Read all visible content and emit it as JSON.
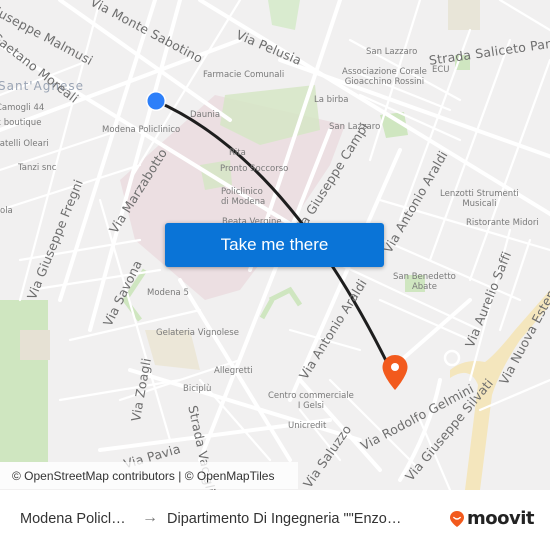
{
  "map": {
    "district": "Sant'Agnese",
    "streets": [
      {
        "id": "monte-sabotino",
        "name": "Via Monte Sabotino"
      },
      {
        "id": "malmusi",
        "name": "Via Giuseppe Malmusi"
      },
      {
        "id": "moreali",
        "name": "Viale Gaetano Moreali"
      },
      {
        "id": "pelusia",
        "name": "Via Pelusia"
      },
      {
        "id": "saliceto",
        "name": "Strada Saliceto Panaro"
      },
      {
        "id": "marzabotto",
        "name": "Via Marzabotto"
      },
      {
        "id": "fregni",
        "name": "Via Giuseppe Fregni"
      },
      {
        "id": "savona",
        "name": "Via Savona"
      },
      {
        "id": "campi",
        "name": "Via Giuseppe Campi"
      },
      {
        "id": "araldi-n",
        "name": "Via Antonio Araldi"
      },
      {
        "id": "araldi-s",
        "name": "Via Antonio Araldi"
      },
      {
        "id": "saffi",
        "name": "Via Aurelio Saffi"
      },
      {
        "id": "estense",
        "name": "Via Nuova Estense"
      },
      {
        "id": "zoagli",
        "name": "Via Zoagli"
      },
      {
        "id": "vaciglio",
        "name": "Strada Vaciglio"
      },
      {
        "id": "pavia",
        "name": "Via Pavia"
      },
      {
        "id": "gelmini",
        "name": "Via Rodolfo Gelmini"
      },
      {
        "id": "silvati",
        "name": "Via Giuseppe Silvati"
      },
      {
        "id": "saluzzo",
        "name": "Via Saluzzo"
      }
    ],
    "pois": [
      {
        "id": "farmacie",
        "name": "Farmacie Comunali"
      },
      {
        "id": "san-lazzaro-1",
        "name": "San Lazzaro"
      },
      {
        "id": "assoc",
        "name": "Associazione Corale\nGioacchino Rossini"
      },
      {
        "id": "ecu",
        "name": "ECU"
      },
      {
        "id": "la-birba",
        "name": "La birba"
      },
      {
        "id": "san-lazzaro-2",
        "name": "San Lazzaro"
      },
      {
        "id": "camogli",
        "name": "Camogli 44"
      },
      {
        "id": "boutique",
        "name": "x boutique"
      },
      {
        "id": "oleari",
        "name": "Fratelli Oleari"
      },
      {
        "id": "tanzi",
        "name": "Tanzi snc"
      },
      {
        "id": "policlinico-stop",
        "name": "Modena Policlinico"
      },
      {
        "id": "daunia",
        "name": "Daunia"
      },
      {
        "id": "rita",
        "name": "Rita"
      },
      {
        "id": "pronto",
        "name": "Pronto Soccorso"
      },
      {
        "id": "policlinico",
        "name": "Policlinico\ndi Modena"
      },
      {
        "id": "beata",
        "name": "Beata Vergine"
      },
      {
        "id": "lenzotti",
        "name": "Lenzotti Strumenti\nMusicali"
      },
      {
        "id": "midori",
        "name": "Ristorante Midori"
      },
      {
        "id": "benedetto",
        "name": "San Benedetto\nAbate"
      },
      {
        "id": "modena5",
        "name": "Modena 5"
      },
      {
        "id": "gelateria",
        "name": "Gelateria Vignolese"
      },
      {
        "id": "allegretti",
        "name": "Allegretti"
      },
      {
        "id": "bicipiu",
        "name": "Biciplù"
      },
      {
        "id": "gelsi",
        "name": "Centro commerciale\nI Gelsi"
      },
      {
        "id": "unicredit",
        "name": "Unicredit"
      },
      {
        "id": "ola",
        "name": "ola"
      }
    ],
    "origin_marker": {
      "label": "origin-marker",
      "color": "#2d7ff9"
    },
    "destination_marker": {
      "label": "destination-marker",
      "color": "#f25a1d"
    },
    "route_color": "#1e1e1e"
  },
  "cta": {
    "label": "Take me there",
    "color": "#0a74d7"
  },
  "attribution": {
    "osm": "© OpenStreetMap contributors",
    "sep": " | ",
    "omt": "© OpenMapTiles"
  },
  "footer": {
    "origin": "Modena Policl…",
    "arrow": "→",
    "destination": "Dipartimento Di Ingegneria \"\"Enzo…",
    "brand": "moovit",
    "brand_color": "#f25a1d"
  }
}
